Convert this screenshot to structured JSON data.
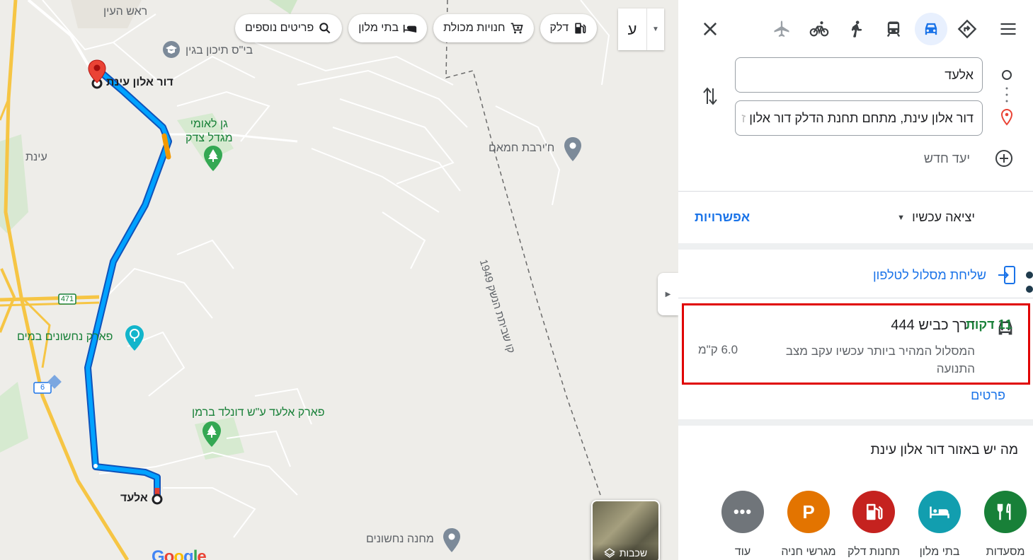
{
  "map": {
    "chips": {
      "more_places": "פריטים נוספים",
      "hotels": "בתי מלון",
      "groceries": "חנויות מכולת",
      "fuel": "דלק"
    },
    "more_chip_letter": "ע",
    "labels": {
      "rosh_haayin": "ראש העין",
      "school": "בי\"ס תיכון בגין",
      "dor_alon": "דור אלון עינת",
      "national_park": "גן לאומי\nמגדל צדק",
      "khirbet": "ח'ירבת חמאם",
      "einat": "עינת",
      "armistice": "קו שביתת הנשק 1949",
      "nachshonim_park": "פארק נחשונים במים",
      "elad_park": "פארק אלעד ע\"ש דונלד ברמן",
      "elad": "אלעד",
      "camp": "מחנה נחשונים",
      "road_471": "471",
      "road_6": "6"
    },
    "layers_label": "שכבות",
    "google": "Google"
  },
  "panel": {
    "origin": "אלעד",
    "destination": "דור אלון עינת, מתחם תחנת הדלק דור אלון",
    "destination_fade": "ז",
    "new_destination": "יעד חדש",
    "depart_now": "יציאה עכשיו",
    "options": "אפשרויות",
    "send_to_phone": "שליחת מסלול לטלפון",
    "route": {
      "name": "דרך כביש 444",
      "time": "11 דקות",
      "description": "המסלול המהיר ביותר עכשיו עקב מצב התנועה",
      "distance": "6.0 ק\"מ"
    },
    "details": "פרטים",
    "nearby_title": "מה יש באזור דור אלון עינת",
    "categories": [
      {
        "label": "מסעדות",
        "color": "#188038"
      },
      {
        "label": "בתי מלון",
        "color": "#129eaf"
      },
      {
        "label": "תחנות דלק",
        "color": "#c5221f"
      },
      {
        "label": "מגרשי חניה",
        "color": "#e37400"
      },
      {
        "label": "עוד",
        "color": "#70757a"
      }
    ]
  },
  "colors": {
    "route": "#1a73e8",
    "accent_blue": "#1a73e8",
    "highlight_border": "#e00000",
    "time_green": "#188038"
  }
}
